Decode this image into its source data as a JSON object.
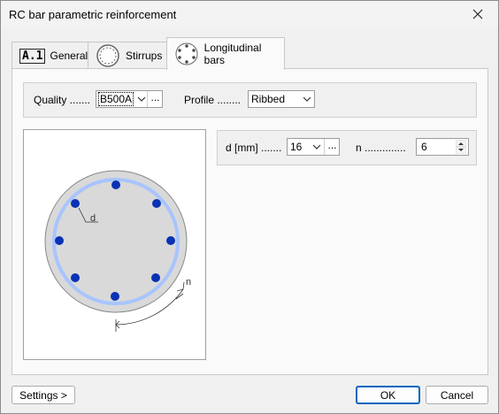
{
  "window": {
    "title": "RC bar parametric reinforcement"
  },
  "icons": {
    "close": "close-icon",
    "general": "a1-icon",
    "stirrups": "stirrup-ring-icon",
    "longitudinal": "bar-ring-icon",
    "spinner": "spinner-arrows-icon",
    "dropdown": "chevron-down-icon"
  },
  "tabs": {
    "general": "General",
    "stirrups": "Stirrups",
    "longitudinal": "Longitudinal bars",
    "general_icon_text": "A.1"
  },
  "quality": {
    "label": "Quality .......",
    "value": "B500A",
    "more": "..."
  },
  "profile": {
    "label": "Profile ........",
    "value": "Ribbed"
  },
  "diameter": {
    "label": "d [mm] .......",
    "value": "16",
    "more": "..."
  },
  "count": {
    "label": "n ..............",
    "value": "6"
  },
  "preview": {
    "d_label": "d",
    "n_label": "n",
    "bars_shown": 8
  },
  "buttons": {
    "settings": "Settings >",
    "ok": "OK",
    "cancel": "Cancel"
  },
  "colors": {
    "accent": "#0067c0",
    "bar": "#0a32b4",
    "stirrup": "#a8c4ff",
    "section": "#d9d9d9"
  }
}
